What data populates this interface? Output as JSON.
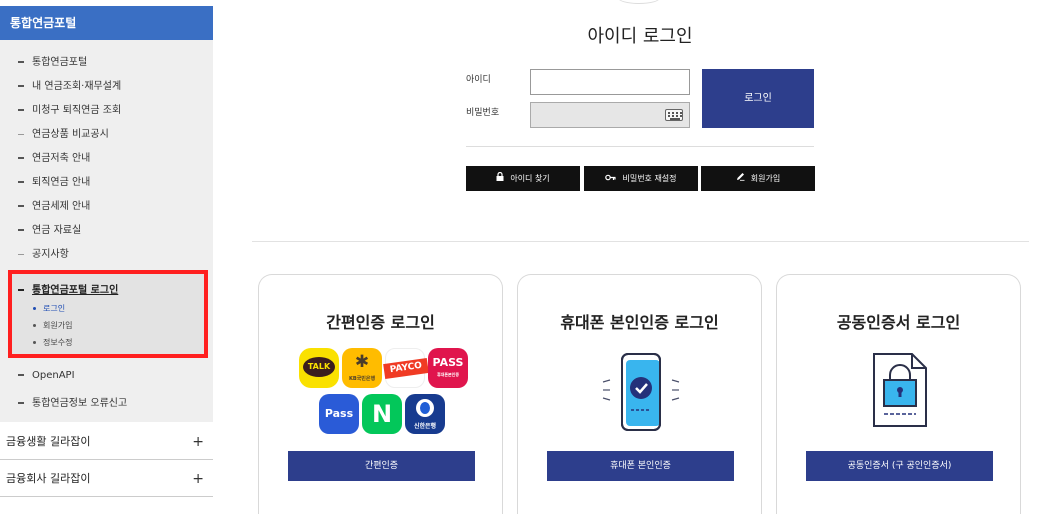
{
  "sidebar": {
    "header": "통합연금포털",
    "items": [
      {
        "label": "통합연금포털"
      },
      {
        "label": "내 연금조회·재무설계"
      },
      {
        "label": "미청구 퇴직연금 조회"
      },
      {
        "label": "연금상품 비교공시"
      },
      {
        "label": "연금저축 안내"
      },
      {
        "label": "퇴직연금 안내"
      },
      {
        "label": "연금세제 안내"
      },
      {
        "label": "연금 자료실"
      },
      {
        "label": "공지사항"
      }
    ],
    "login_section": {
      "title": "통합연금포털 로그인",
      "subitems": [
        {
          "label": "로그인"
        },
        {
          "label": "회원가입"
        },
        {
          "label": "정보수정"
        }
      ]
    },
    "after_items": [
      {
        "label": "OpenAPI"
      },
      {
        "label": "통합연금정보 오류신고"
      }
    ],
    "guides": [
      {
        "label": "금융생활 길라잡이",
        "icon": "+"
      },
      {
        "label": "금융회사 길라잡이",
        "icon": "+"
      }
    ]
  },
  "login": {
    "title": "아이디 로그인",
    "id_label": "아이디",
    "pw_label": "비밀번호",
    "login_button": "로그인",
    "find_id": "아이디 찾기",
    "reset_pw": "비밀번호 재설정",
    "signup": "회원가입"
  },
  "cards": [
    {
      "title": "간편인증 로그인",
      "button": "간편인증"
    },
    {
      "title": "휴대폰 본인인증 로그인",
      "button": "휴대폰 본인인증"
    },
    {
      "title": "공동인증서 로그인",
      "button": "공동인증서 (구 공인인증서)"
    }
  ],
  "apps": {
    "talk": "TALK",
    "kb": "KB국민은행",
    "payco": "PAYCO",
    "pass1": "PASS",
    "pass1_sub": "휴대폰본인증",
    "pass2": "Pass",
    "naver": "N",
    "shinhan": "신한은행"
  },
  "colors": {
    "sidebar_header": "#3a6fc4",
    "navy_button": "#2d3e8c",
    "highlight_border": "#ff1f1f"
  }
}
